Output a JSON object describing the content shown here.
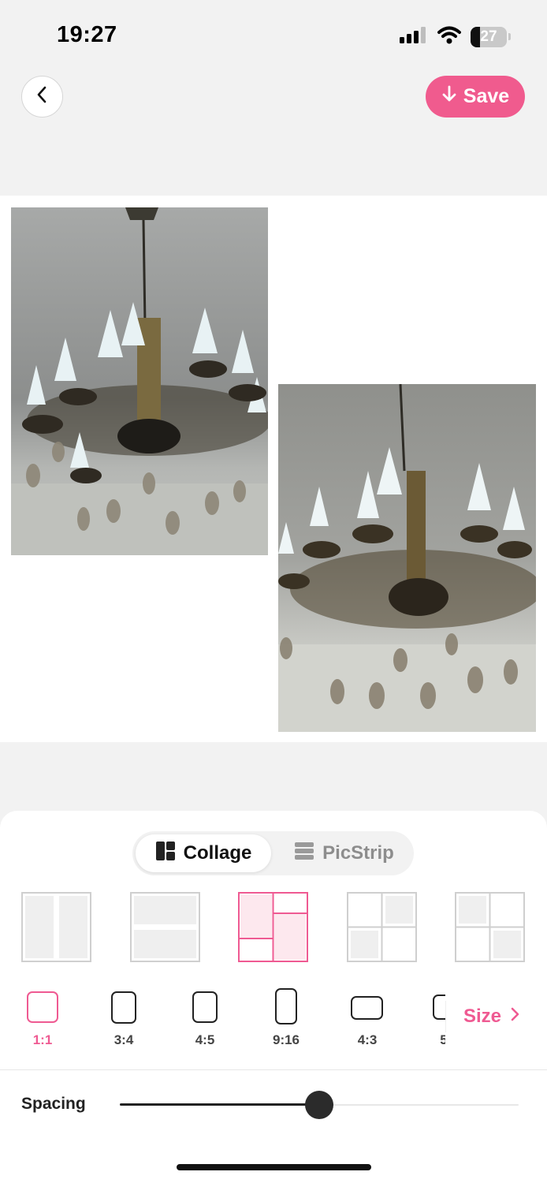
{
  "status_bar": {
    "time": "19:27",
    "battery": "27",
    "battery_level": 0.27
  },
  "header": {
    "save_label": "Save"
  },
  "collage_photos": [
    {
      "subject": "chandelier photo"
    },
    {
      "subject": "chandelier photo"
    }
  ],
  "mode_tabs": [
    {
      "label": "Collage",
      "icon": "collage-grid-icon",
      "selected": true
    },
    {
      "label": "PicStrip",
      "icon": "picstrip-icon",
      "selected": false
    }
  ],
  "layouts": [
    {
      "name": "two-columns",
      "selected": false
    },
    {
      "name": "two-rows",
      "selected": false
    },
    {
      "name": "staggered-columns",
      "selected": true
    },
    {
      "name": "grid-diagonal-top-right",
      "selected": false
    },
    {
      "name": "grid-diagonal-top-left",
      "selected": false
    }
  ],
  "ratios": [
    {
      "label": "1:1",
      "selected": true
    },
    {
      "label": "3:4",
      "selected": false
    },
    {
      "label": "4:5",
      "selected": false
    },
    {
      "label": "9:16",
      "selected": false
    },
    {
      "label": "4:3",
      "selected": false
    },
    {
      "label": "5",
      "selected": false
    }
  ],
  "size_button": {
    "label": "Size"
  },
  "spacing": {
    "label": "Spacing",
    "value": 0.5
  },
  "colors": {
    "accent": "#f05b8e",
    "accent_light": "#fde8ee"
  }
}
